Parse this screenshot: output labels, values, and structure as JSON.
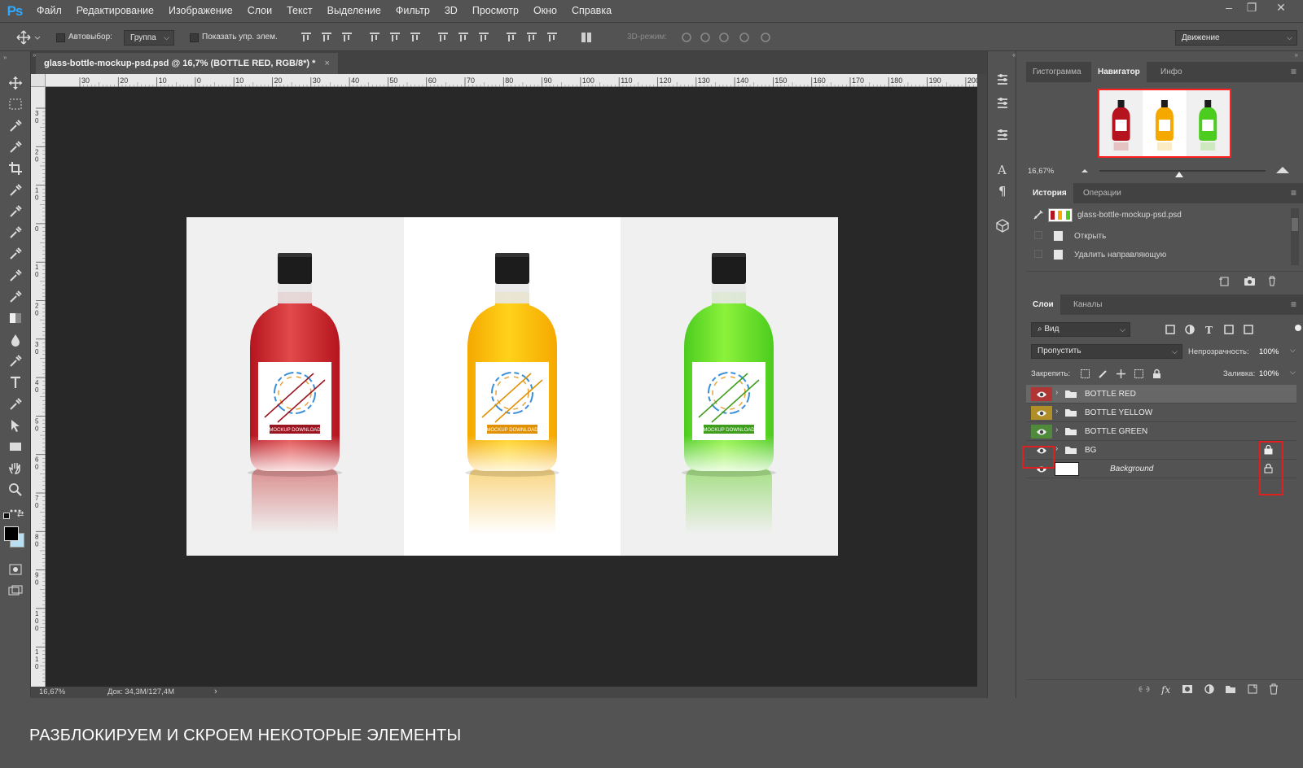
{
  "app": {
    "logo": "Ps"
  },
  "menu": [
    "Файл",
    "Редактирование",
    "Изображение",
    "Слои",
    "Текст",
    "Выделение",
    "Фильтр",
    "3D",
    "Просмотр",
    "Окно",
    "Справка"
  ],
  "options": {
    "autoselect_label": "Автовыбор:",
    "autoselect_value": "Группа",
    "show_transform_label": "Показать упр. элем.",
    "mode_3d_label": "3D-режим:",
    "workspace_value": "Движение"
  },
  "document": {
    "tab_title": "glass-bottle-mockup-psd.psd @ 16,7% (BOTTLE RED, RGB/8*) *",
    "close_glyph": "×",
    "zoom": "16,67%",
    "doc_info": "Док: 34,3M/127,4M",
    "ruler_top": [
      "30",
      "20",
      "10",
      "0",
      "10",
      "20",
      "30",
      "40",
      "50",
      "60",
      "70",
      "80",
      "90",
      "100",
      "110",
      "120",
      "130",
      "140",
      "150",
      "160",
      "170",
      "180",
      "190",
      "200"
    ],
    "ruler_left": [
      "3\n0",
      "2\n0",
      "1\n0",
      "0",
      "1\n0",
      "2\n0",
      "3\n0",
      "4\n0",
      "5\n0",
      "6\n0",
      "7\n0",
      "8\n0",
      "9\n0",
      "1\n0\n0",
      "1\n1\n0"
    ]
  },
  "canvas": {
    "bottles": [
      {
        "name": "bottle-red",
        "liquid": "#b5141e",
        "liquid_light": "#e24a4a",
        "bg": "#f0f0f0",
        "reflection": "#c83c3c",
        "band": "#9b1520",
        "band_text": "MOCKUP DOWNLOAD"
      },
      {
        "name": "bottle-yellow",
        "liquid": "#f5a800",
        "liquid_light": "#ffd21a",
        "bg": "#ffffff",
        "reflection": "#f2b21a",
        "band": "#e09000",
        "band_text": "MOCKUP DOWNLOAD"
      },
      {
        "name": "bottle-green",
        "liquid": "#4ccc1e",
        "liquid_light": "#8cf23c",
        "bg": "#f0f0f0",
        "reflection": "#66d02a",
        "band": "#3e9e1c",
        "band_text": "MOCKUP DOWNLOAD"
      }
    ]
  },
  "navigator": {
    "tabs": [
      "Гистограмма",
      "Навигатор",
      "Инфо"
    ],
    "active_tab": "Навигатор",
    "zoom": "16,67%",
    "zoom_slider_fraction": 0.48
  },
  "history": {
    "tabs": [
      "История",
      "Операции"
    ],
    "active_tab": "История",
    "snapshot": "glass-bottle-mockup-psd.psd",
    "items": [
      "Открыть",
      "Удалить направляющую"
    ]
  },
  "layers": {
    "tabs": [
      "Слои",
      "Каналы"
    ],
    "active_tab": "Слои",
    "filter_label": "Вид",
    "blend_mode": "Пропустить",
    "opacity_label": "Непрозрачность:",
    "opacity": "100%",
    "lock_label": "Закрепить:",
    "fill_label": "Заливка:",
    "fill": "100%",
    "rows": [
      {
        "name": "BOTTLE RED",
        "type": "group",
        "color": "#b03535",
        "selected": true,
        "locked": false
      },
      {
        "name": "BOTTLE YELLOW",
        "type": "group",
        "color": "#b08f28",
        "selected": false,
        "locked": false
      },
      {
        "name": "BOTTLE GREEN",
        "type": "group",
        "color": "#4f8a3a",
        "selected": false,
        "locked": false
      },
      {
        "name": "BG",
        "type": "group",
        "color": "",
        "selected": false,
        "locked": true
      },
      {
        "name": "Background",
        "type": "pixel",
        "color": "",
        "selected": false,
        "locked": true
      }
    ]
  },
  "caption": "РАЗБЛОКИРУЕМ И СКРОЕМ НЕКОТОРЫЕ ЭЛЕМЕНТЫ",
  "colors": {
    "ui_bg": "#535353",
    "pasteboard": "#282828",
    "highlight_red": "#e02020",
    "nav_frame": "#ff2020"
  }
}
